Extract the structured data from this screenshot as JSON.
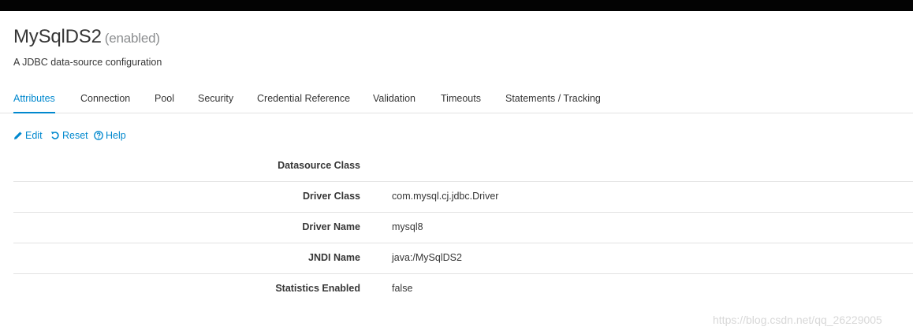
{
  "header": {
    "title": "MySqlDS2",
    "state": "(enabled)",
    "description": "A JDBC data-source configuration"
  },
  "tabs": [
    {
      "label": "Attributes",
      "active": true
    },
    {
      "label": "Connection",
      "active": false
    },
    {
      "label": "Pool",
      "active": false
    },
    {
      "label": "Security",
      "active": false
    },
    {
      "label": "Credential Reference",
      "active": false
    },
    {
      "label": "Validation",
      "active": false
    },
    {
      "label": "Timeouts",
      "active": false
    },
    {
      "label": "Statements / Tracking",
      "active": false
    }
  ],
  "actions": {
    "edit": {
      "label": "Edit",
      "icon": "pencil-icon"
    },
    "reset": {
      "label": "Reset",
      "icon": "undo-icon"
    },
    "help": {
      "label": "Help",
      "icon": "question-circle-icon"
    }
  },
  "attributes": [
    {
      "name": "Datasource Class",
      "value": ""
    },
    {
      "name": "Driver Class",
      "value": "com.mysql.cj.jdbc.Driver"
    },
    {
      "name": "Driver Name",
      "value": "mysql8"
    },
    {
      "name": "JNDI Name",
      "value": "java:/MySqlDS2"
    },
    {
      "name": "Statistics Enabled",
      "value": "false"
    }
  ],
  "watermark": "https://blog.csdn.net/qq_26229005",
  "colors": {
    "accent": "#0088ce",
    "topbar": "#030303",
    "text": "#363636",
    "muted": "#8b8d8f",
    "divider": "#e3e3e3"
  }
}
